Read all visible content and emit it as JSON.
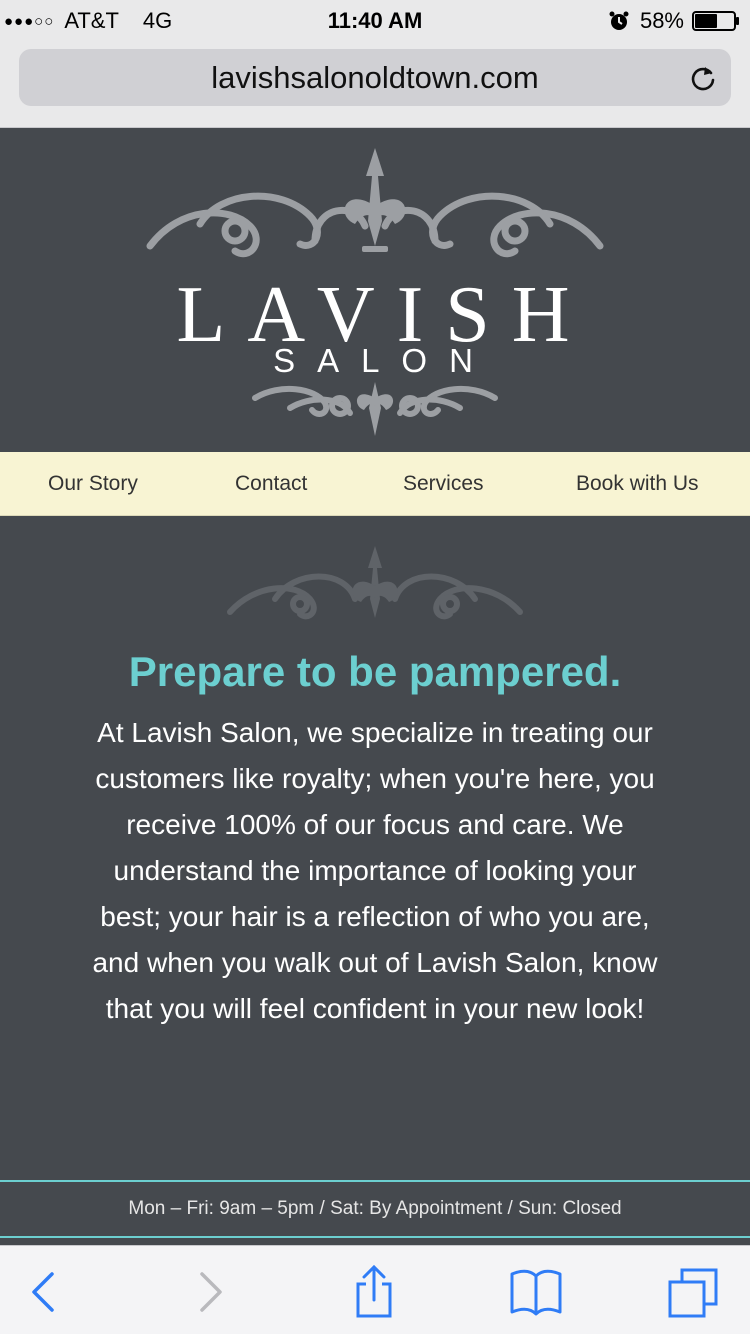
{
  "status_bar": {
    "signal_dots": "●●●○○",
    "carrier": "AT&T",
    "network": "4G",
    "time": "11:40 AM",
    "battery_percent": "58%",
    "battery_level": 0.58
  },
  "browser": {
    "url": "lavishsalonoldtown.com"
  },
  "logo": {
    "title": "LAVISH",
    "subtitle": "SALON"
  },
  "nav": {
    "items": [
      {
        "label": "Our Story"
      },
      {
        "label": "Contact"
      },
      {
        "label": "Services"
      },
      {
        "label": "Book with Us"
      }
    ]
  },
  "main": {
    "headline": "Prepare to be pampered.",
    "intro": "At Lavish Salon, we specialize in treating our customers like royalty; when you're here, you receive 100% of our focus and care. We understand the importance of looking your best; your hair is a reflection of who you are, and when you walk out of Lavish Salon, know that you will feel confident in your new look!"
  },
  "hours": {
    "text": "Mon – Fri: 9am – 5pm / Sat: By Appointment / Sun: Closed"
  },
  "colors": {
    "background": "#45494e",
    "nav_bg": "#f8f4d3",
    "accent": "#6ccfd0",
    "ornament": "#9c9fa3",
    "ios_blue": "#2f7cf6"
  },
  "icons": {
    "reload": "reload-icon",
    "back": "back-chevron-icon",
    "forward": "forward-chevron-icon",
    "share": "share-icon",
    "bookmarks": "bookmarks-icon",
    "tabs": "tabs-icon"
  }
}
